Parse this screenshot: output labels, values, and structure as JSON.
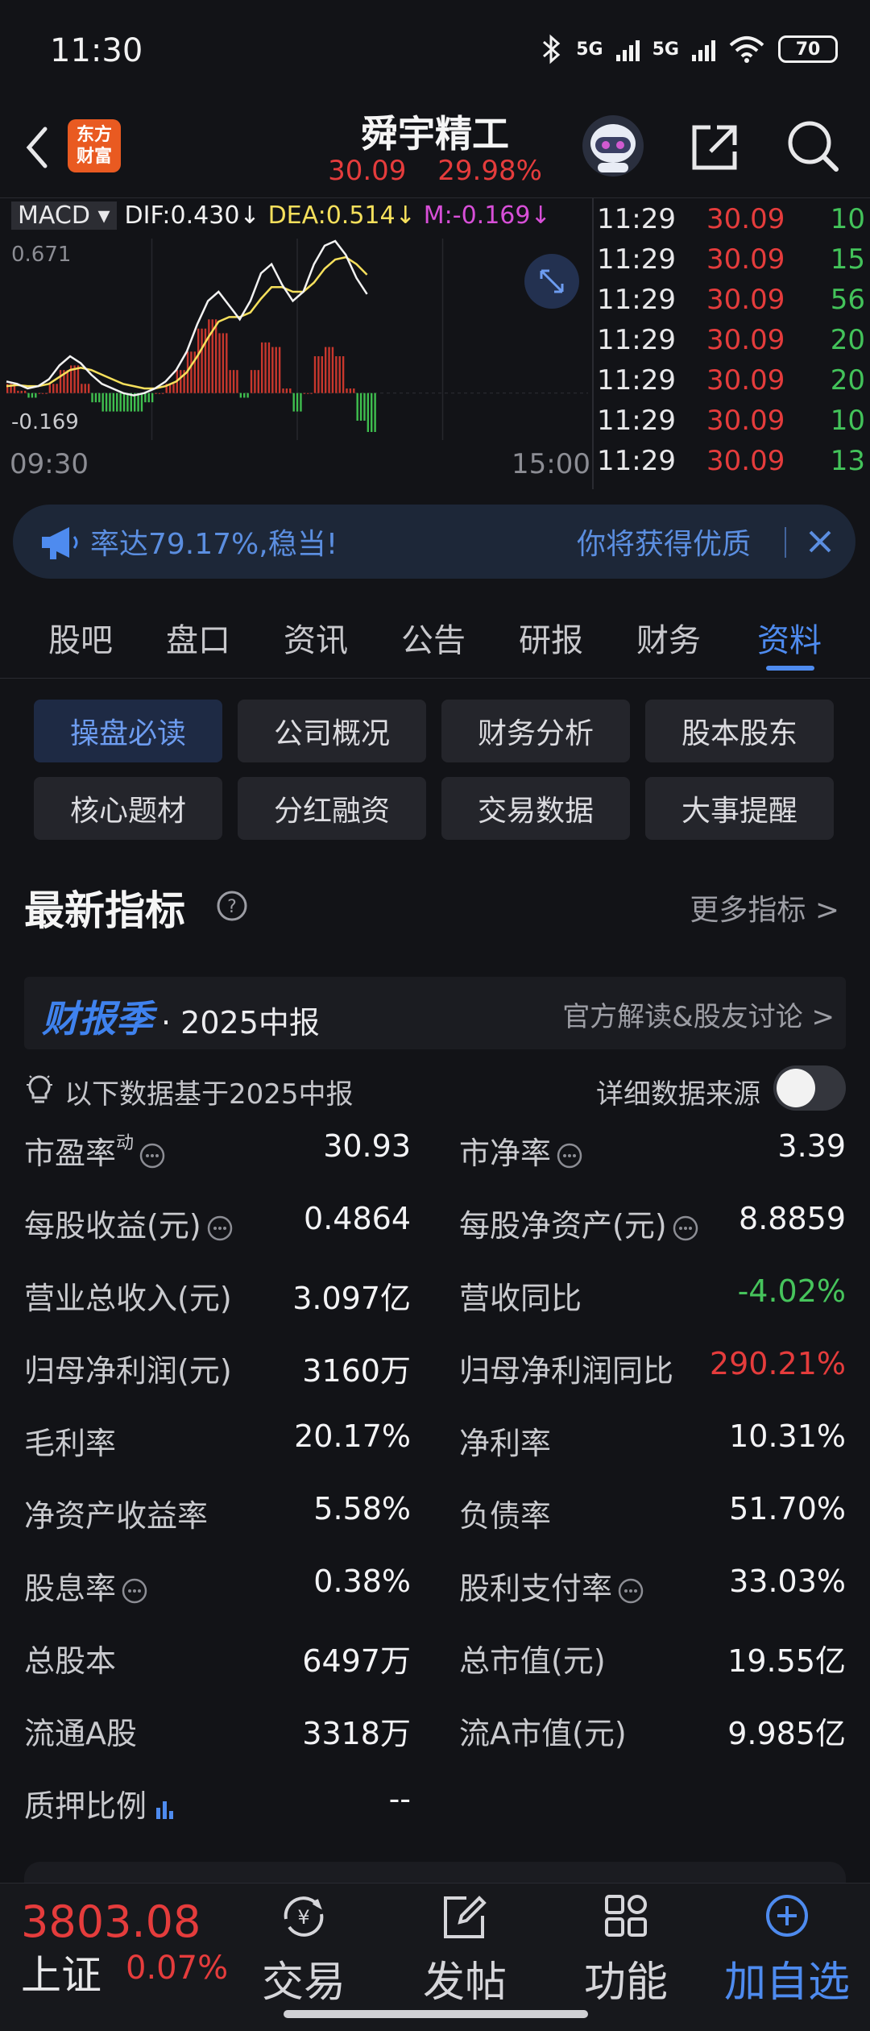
{
  "status_bar": {
    "time": "11:30",
    "signal1": "5G",
    "signal2": "5G",
    "battery": "70"
  },
  "header": {
    "back_label": "",
    "logo_text_line1": "东方",
    "logo_text_line2": "财富",
    "stock_name": "舜宇精工",
    "price": "30.09",
    "change_pct": "29.98%"
  },
  "chart": {
    "indicator": "MACD",
    "dif": "DIF:0.430↓",
    "dea": "DEA:0.514↓",
    "m": "M:-0.169↓",
    "max_label": "0.671",
    "min_label": "-0.169",
    "time_start": "09:30",
    "time_end": "15:00"
  },
  "chart_data": {
    "type": "line",
    "title": "",
    "xlabel": "",
    "ylabel": "",
    "ylim": [
      -0.169,
      0.671
    ],
    "x_range": [
      "09:30",
      "15:00"
    ],
    "series": [
      {
        "name": "DIF",
        "values": [
          0.05,
          0.04,
          0.02,
          0.03,
          0.06,
          0.12,
          0.16,
          0.13,
          0.08,
          0.04,
          0.02,
          0.0,
          -0.01,
          0.0,
          0.02,
          0.05,
          0.1,
          0.18,
          0.3,
          0.4,
          0.44,
          0.38,
          0.32,
          0.4,
          0.52,
          0.56,
          0.47,
          0.4,
          0.44,
          0.56,
          0.64,
          0.66,
          0.6,
          0.5,
          0.43
        ]
      },
      {
        "name": "DEA",
        "values": [
          0.03,
          0.035,
          0.03,
          0.03,
          0.04,
          0.07,
          0.1,
          0.11,
          0.1,
          0.08,
          0.06,
          0.04,
          0.03,
          0.02,
          0.02,
          0.03,
          0.05,
          0.09,
          0.16,
          0.24,
          0.31,
          0.33,
          0.33,
          0.35,
          0.41,
          0.46,
          0.46,
          0.44,
          0.44,
          0.48,
          0.54,
          0.58,
          0.59,
          0.56,
          0.514
        ]
      },
      {
        "name": "M",
        "values": [
          0.04,
          0.01,
          -0.02,
          0.0,
          0.04,
          0.1,
          0.12,
          0.04,
          -0.04,
          -0.08,
          -0.08,
          -0.08,
          -0.08,
          -0.04,
          0.0,
          0.04,
          0.1,
          0.18,
          0.28,
          0.32,
          0.26,
          0.1,
          -0.02,
          0.1,
          0.22,
          0.2,
          0.02,
          -0.08,
          0.0,
          0.16,
          0.2,
          0.16,
          0.02,
          -0.12,
          -0.169
        ]
      }
    ]
  },
  "ticks": [
    {
      "time": "11:29",
      "price": "30.09",
      "volume": "10"
    },
    {
      "time": "11:29",
      "price": "30.09",
      "volume": "15"
    },
    {
      "time": "11:29",
      "price": "30.09",
      "volume": "56"
    },
    {
      "time": "11:29",
      "price": "30.09",
      "volume": "20"
    },
    {
      "time": "11:29",
      "price": "30.09",
      "volume": "20"
    },
    {
      "time": "11:29",
      "price": "30.09",
      "volume": "10"
    },
    {
      "time": "11:29",
      "price": "30.09",
      "volume": "13"
    }
  ],
  "banner": {
    "left_text": "率达79.17%,稳当!",
    "right_text": "你将获得优质"
  },
  "tabs": [
    "股吧",
    "盘口",
    "资讯",
    "公告",
    "研报",
    "财务",
    "资料"
  ],
  "active_tab": "资料",
  "sub_tabs": [
    "操盘必读",
    "公司概况",
    "财务分析",
    "股本股东",
    "核心题材",
    "分红融资",
    "交易数据",
    "大事提醒"
  ],
  "section": {
    "title": "最新指标",
    "more": "更多指标 >"
  },
  "report": {
    "tag": "财报季",
    "period": "· 2025中报",
    "link": "官方解读&股友讨论 >"
  },
  "basis": {
    "text": "以下数据基于2025中报",
    "source_label": "详细数据来源",
    "source_toggle": "off"
  },
  "metrics": [
    {
      "label": "市盈率",
      "sup": "动",
      "info": true,
      "value": "30.93",
      "tone": ""
    },
    {
      "label": "市净率",
      "sup": "",
      "info": true,
      "value": "3.39",
      "tone": ""
    },
    {
      "label": "每股收益(元)",
      "sup": "",
      "info": true,
      "value": "0.4864",
      "tone": ""
    },
    {
      "label": "每股净资产(元)",
      "sup": "",
      "info": true,
      "value": "8.8859",
      "tone": ""
    },
    {
      "label": "营业总收入(元)",
      "sup": "",
      "info": false,
      "value": "3.097亿",
      "tone": ""
    },
    {
      "label": "营收同比",
      "sup": "",
      "info": false,
      "value": "-4.02%",
      "tone": "down"
    },
    {
      "label": "归母净利润(元)",
      "sup": "",
      "info": false,
      "value": "3160万",
      "tone": ""
    },
    {
      "label": "归母净利润同比",
      "sup": "",
      "info": false,
      "value": "290.21%",
      "tone": "up"
    },
    {
      "label": "毛利率",
      "sup": "",
      "info": false,
      "value": "20.17%",
      "tone": ""
    },
    {
      "label": "净利率",
      "sup": "",
      "info": false,
      "value": "10.31%",
      "tone": ""
    },
    {
      "label": "净资产收益率",
      "sup": "",
      "info": false,
      "value": "5.58%",
      "tone": ""
    },
    {
      "label": "负债率",
      "sup": "",
      "info": false,
      "value": "51.70%",
      "tone": ""
    },
    {
      "label": "股息率",
      "sup": "",
      "info": true,
      "value": "0.38%",
      "tone": ""
    },
    {
      "label": "股利支付率",
      "sup": "",
      "info": true,
      "value": "33.03%",
      "tone": ""
    },
    {
      "label": "总股本",
      "sup": "",
      "info": false,
      "value": "6497万",
      "tone": ""
    },
    {
      "label": "总市值(元)",
      "sup": "",
      "info": false,
      "value": "19.55亿",
      "tone": ""
    },
    {
      "label": "流通A股",
      "sup": "",
      "info": false,
      "value": "3318万",
      "tone": ""
    },
    {
      "label": "流A市值(元)",
      "sup": "",
      "info": false,
      "value": "9.985亿",
      "tone": ""
    },
    {
      "label": "质押比例",
      "sup": "",
      "info": false,
      "chart_icon": true,
      "value": "--",
      "tone": ""
    }
  ],
  "bottom_nav": {
    "index_value": "3803.08",
    "index_name": "上证",
    "index_change": "0.07%",
    "items": [
      {
        "label": "交易",
        "icon": "yuan-cycle-icon"
      },
      {
        "label": "发帖",
        "icon": "edit-icon"
      },
      {
        "label": "功能",
        "icon": "grid-icon"
      },
      {
        "label": "加自选",
        "icon": "add-circle-icon"
      }
    ]
  },
  "colors": {
    "up": "#e53c3c",
    "down": "#46c45c",
    "accent": "#4e8bef",
    "background": "#121317"
  }
}
